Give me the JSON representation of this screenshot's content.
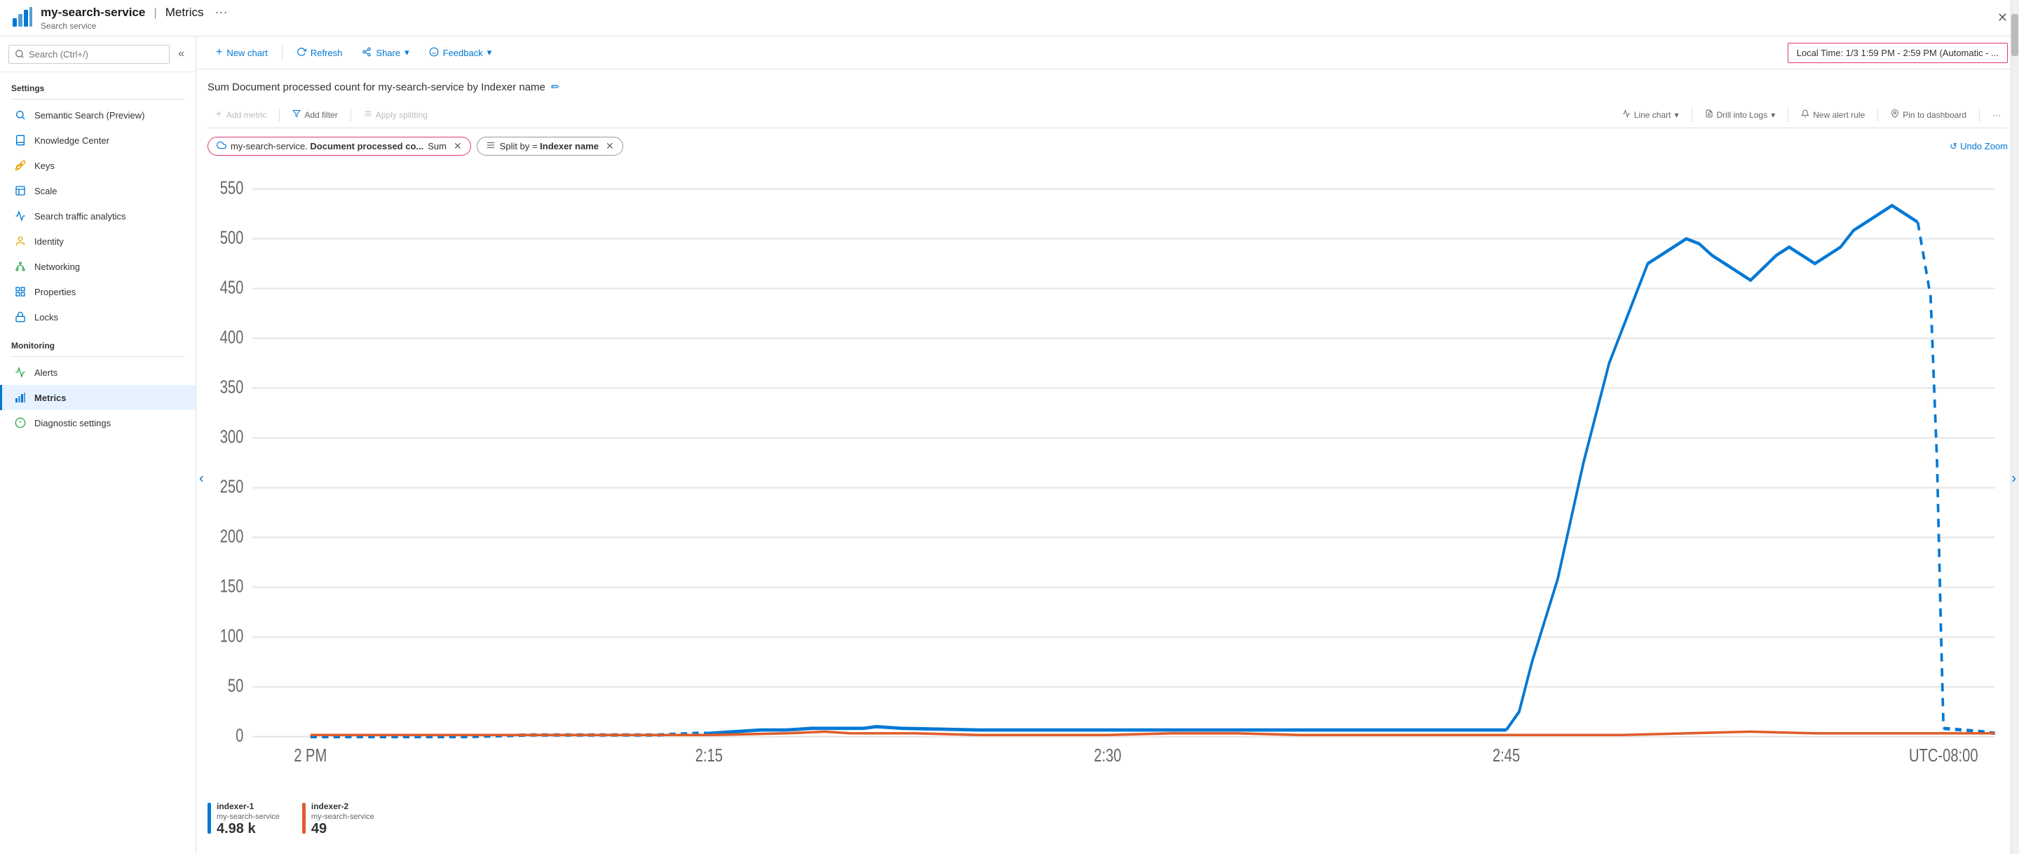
{
  "titleBar": {
    "icon": "chart-icon",
    "serviceName": "my-search-service",
    "separator": "|",
    "page": "Metrics",
    "subLabel": "Search service",
    "dots": "···",
    "close": "✕"
  },
  "sidebar": {
    "searchPlaceholder": "Search (Ctrl+/)",
    "collapseLabel": "«",
    "sections": [
      {
        "title": "Settings",
        "items": [
          {
            "id": "semantic-search",
            "label": "Semantic Search (Preview)",
            "icon": "search-icon",
            "color": "#0078d4"
          },
          {
            "id": "knowledge-center",
            "label": "Knowledge Center",
            "icon": "knowledge-icon",
            "color": "#0078d4"
          },
          {
            "id": "keys",
            "label": "Keys",
            "icon": "key-icon",
            "color": "#e8a000"
          },
          {
            "id": "scale",
            "label": "Scale",
            "icon": "scale-icon",
            "color": "#0078d4"
          },
          {
            "id": "search-traffic-analytics",
            "label": "Search traffic analytics",
            "icon": "analytics-icon",
            "color": "#0078d4"
          },
          {
            "id": "identity",
            "label": "Identity",
            "icon": "identity-icon",
            "color": "#e8a000"
          },
          {
            "id": "networking",
            "label": "Networking",
            "icon": "networking-icon",
            "color": "#28a745"
          },
          {
            "id": "properties",
            "label": "Properties",
            "icon": "properties-icon",
            "color": "#0078d4"
          },
          {
            "id": "locks",
            "label": "Locks",
            "icon": "lock-icon",
            "color": "#0078d4"
          }
        ]
      },
      {
        "title": "Monitoring",
        "items": [
          {
            "id": "alerts",
            "label": "Alerts",
            "icon": "alerts-icon",
            "color": "#28a745"
          },
          {
            "id": "metrics",
            "label": "Metrics",
            "icon": "metrics-icon",
            "color": "#0078d4",
            "active": true
          },
          {
            "id": "diagnostic-settings",
            "label": "Diagnostic settings",
            "icon": "diagnostic-icon",
            "color": "#28a745"
          }
        ]
      }
    ]
  },
  "toolbar": {
    "newChartLabel": "New chart",
    "refreshLabel": "Refresh",
    "shareLabel": "Share",
    "feedbackLabel": "Feedback",
    "timeRange": "Local Time: 1/3 1:59 PM - 2:59 PM (Automatic - ..."
  },
  "chartTitle": "Sum Document processed count for my-search-service by Indexer name",
  "metricsToolbar": {
    "addMetricLabel": "Add metric",
    "addFilterLabel": "Add filter",
    "applySplittingLabel": "Apply splitting",
    "lineChartLabel": "Line chart",
    "drillIntoLogsLabel": "Drill into Logs",
    "newAlertRuleLabel": "New alert rule",
    "pinToDashboardLabel": "Pin to dashboard",
    "moreLabel": "···"
  },
  "pills": {
    "metricPill": {
      "label": "my-search-service. Document processed co...",
      "aggregation": "Sum"
    },
    "splitPill": {
      "label": "Split by = Indexer name"
    }
  },
  "undoZoom": "Undo Zoom",
  "chart": {
    "yAxisLabels": [
      "550",
      "500",
      "450",
      "400",
      "350",
      "300",
      "250",
      "200",
      "150",
      "100",
      "50",
      "0"
    ],
    "xAxisLabels": [
      "2 PM",
      "2:15",
      "2:30",
      "2:45",
      "UTC-08:00"
    ],
    "accentColor": "#0078d4"
  },
  "legend": [
    {
      "id": "indexer-1",
      "label": "indexer-1",
      "sub": "my-search-service",
      "value": "4.98 k",
      "color": "#0078d4"
    },
    {
      "id": "indexer-2",
      "label": "indexer-2",
      "sub": "my-search-service",
      "value": "49",
      "color": "#e05c2a"
    }
  ]
}
